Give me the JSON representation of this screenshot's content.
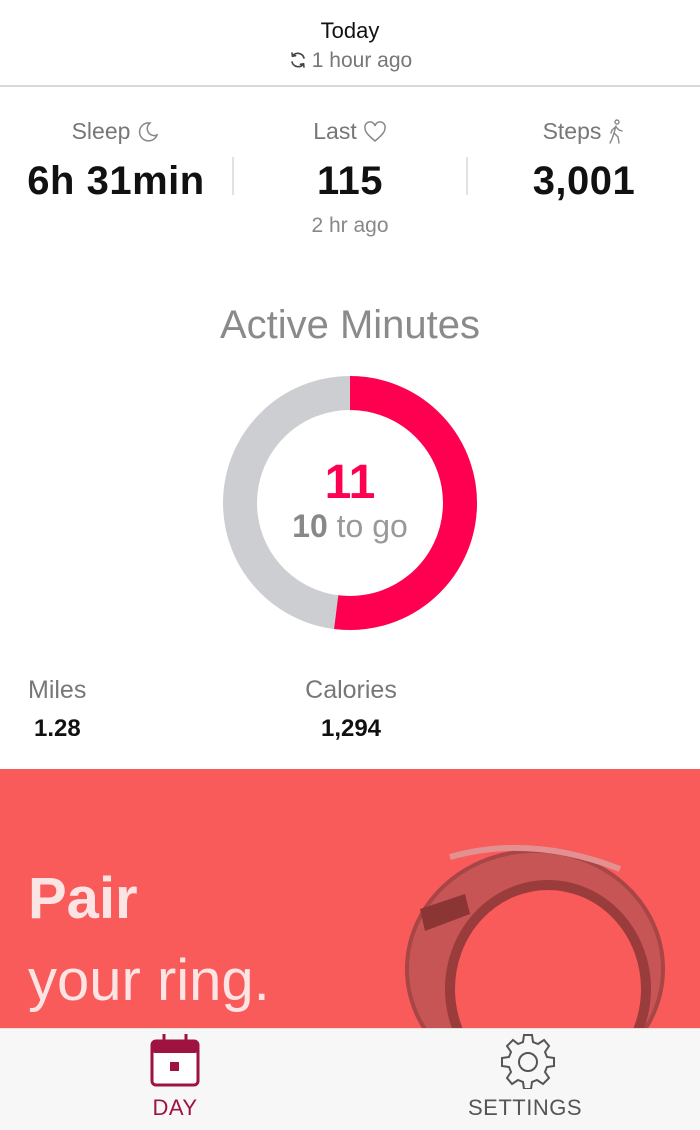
{
  "header": {
    "title": "Today",
    "sync_text": "1 hour ago"
  },
  "stats": {
    "sleep": {
      "label": "Sleep",
      "value": "6h 31min"
    },
    "last": {
      "label": "Last",
      "value": "115",
      "sub": "2 hr ago"
    },
    "steps": {
      "label": "Steps",
      "value": "3,001"
    }
  },
  "active_minutes": {
    "title": "Active Minutes",
    "value": "11",
    "remaining": "10",
    "remaining_suffix": "to go",
    "progress_fraction": 0.52
  },
  "metrics": {
    "miles": {
      "label": "Miles",
      "value": "1.28"
    },
    "calories": {
      "label": "Calories",
      "value": "1,294"
    }
  },
  "banner": {
    "title": "Pair",
    "subtitle": "your ring."
  },
  "nav": {
    "day_label": "DAY",
    "settings_label": "SETTINGS"
  },
  "colors": {
    "accent": "#ff0050",
    "track": "#cdced2",
    "banner": "#f95b5b",
    "nav_active": "#9e1340"
  }
}
